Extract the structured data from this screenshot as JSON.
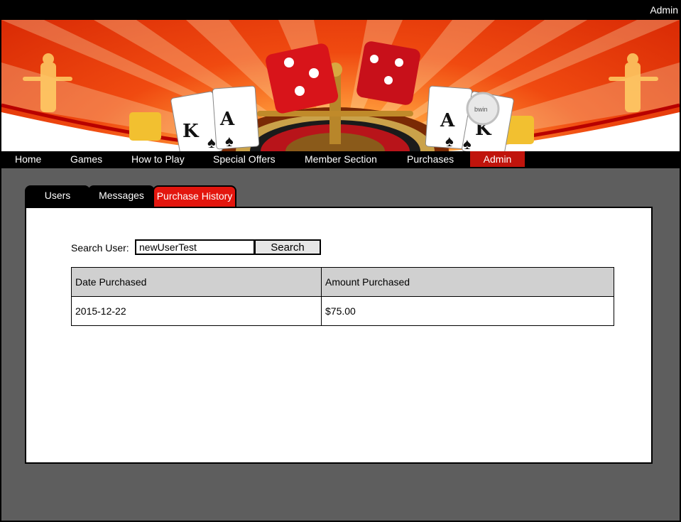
{
  "topbar": {
    "admin_link": "Admin"
  },
  "nav": {
    "items": [
      {
        "label": "Home"
      },
      {
        "label": "Games"
      },
      {
        "label": "How to Play"
      },
      {
        "label": "Special Offers"
      },
      {
        "label": "Member Section"
      },
      {
        "label": "Purchases"
      },
      {
        "label": "Admin"
      }
    ],
    "active": "Admin"
  },
  "tabs": [
    {
      "label": "Users"
    },
    {
      "label": "Messages"
    },
    {
      "label": "Purchase History"
    }
  ],
  "search": {
    "label": "Search User:",
    "value": "newUserTest",
    "button_label": "Search"
  },
  "table": {
    "headers": [
      "Date Purchased",
      "Amount Purchased"
    ],
    "rows": [
      [
        "2015-12-22",
        "$75.00"
      ]
    ]
  },
  "banner": {
    "card_left_1": "K",
    "card_left_2": "A",
    "card_right_1": "A",
    "card_right_2": "K",
    "chip_label": "bwin"
  },
  "colors": {
    "accent_red": "#e3160e",
    "nav_active": "#c0140c",
    "background": "#5e5e5e"
  }
}
